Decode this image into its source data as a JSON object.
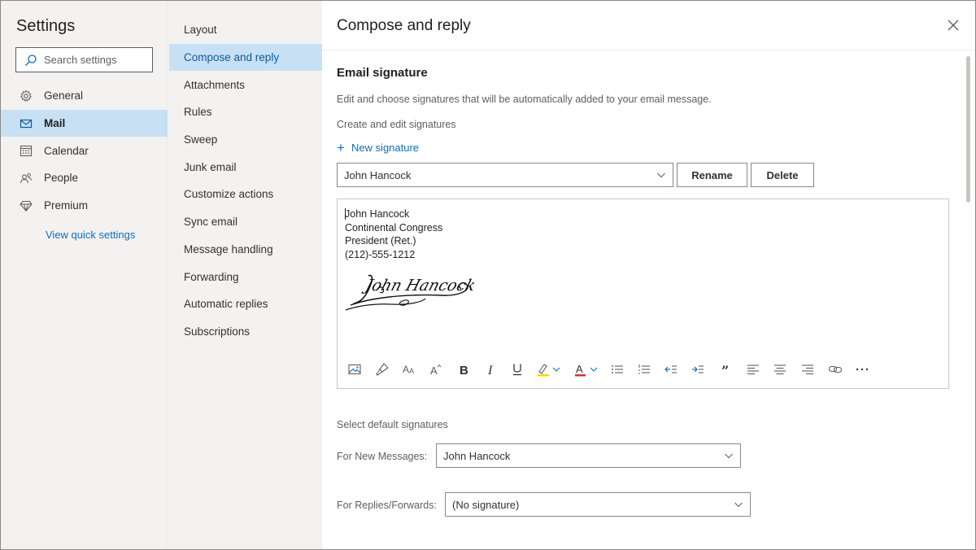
{
  "settings": {
    "title": "Settings",
    "search_placeholder": "Search settings",
    "categories": [
      {
        "label": "General",
        "icon": "gear-icon"
      },
      {
        "label": "Mail",
        "icon": "mail-icon",
        "active": true
      },
      {
        "label": "Calendar",
        "icon": "calendar-icon"
      },
      {
        "label": "People",
        "icon": "people-icon"
      },
      {
        "label": "Premium",
        "icon": "diamond-icon"
      }
    ],
    "quick_settings_link": "View quick settings"
  },
  "mail_nav": {
    "items": [
      {
        "label": "Layout"
      },
      {
        "label": "Compose and reply",
        "active": true
      },
      {
        "label": "Attachments"
      },
      {
        "label": "Rules"
      },
      {
        "label": "Sweep"
      },
      {
        "label": "Junk email"
      },
      {
        "label": "Customize actions"
      },
      {
        "label": "Sync email"
      },
      {
        "label": "Message handling"
      },
      {
        "label": "Forwarding"
      },
      {
        "label": "Automatic replies"
      },
      {
        "label": "Subscriptions"
      }
    ]
  },
  "main": {
    "title": "Compose and reply",
    "email_signature": {
      "heading": "Email signature",
      "description": "Edit and choose signatures that will be automatically added to your email message.",
      "create_label": "Create and edit signatures",
      "new_signature": "New signature",
      "selected_signature": "John Hancock",
      "rename": "Rename",
      "delete": "Delete",
      "body_lines": [
        "John Hancock",
        "Continental Congress",
        "President (Ret.)",
        "(212)-555-1212"
      ],
      "signature_image_text": "John Hancock",
      "toolbar": [
        "insert-picture-icon",
        "format-painter-icon",
        "font-size-icon",
        "grow-font-icon",
        "bold-icon",
        "italic-icon",
        "underline-icon",
        "highlight-icon",
        "font-color-icon",
        "bullets-icon",
        "numbering-icon",
        "decrease-indent-icon",
        "increase-indent-icon",
        "quote-icon",
        "align-left-icon",
        "align-center-icon",
        "align-right-icon",
        "link-icon",
        "more-options-icon"
      ]
    },
    "defaults": {
      "heading": "Select default signatures",
      "new_messages_label": "For New Messages:",
      "new_messages_value": "John Hancock",
      "replies_label": "For Replies/Forwards:",
      "replies_value": "(No signature)"
    }
  },
  "colors": {
    "accent": "#0f6cbd",
    "selected_bg": "#c7e0f4",
    "pane_bg": "#f3f2f1",
    "highlight_yellow": "#ffd400",
    "font_color_red": "#d13438"
  }
}
